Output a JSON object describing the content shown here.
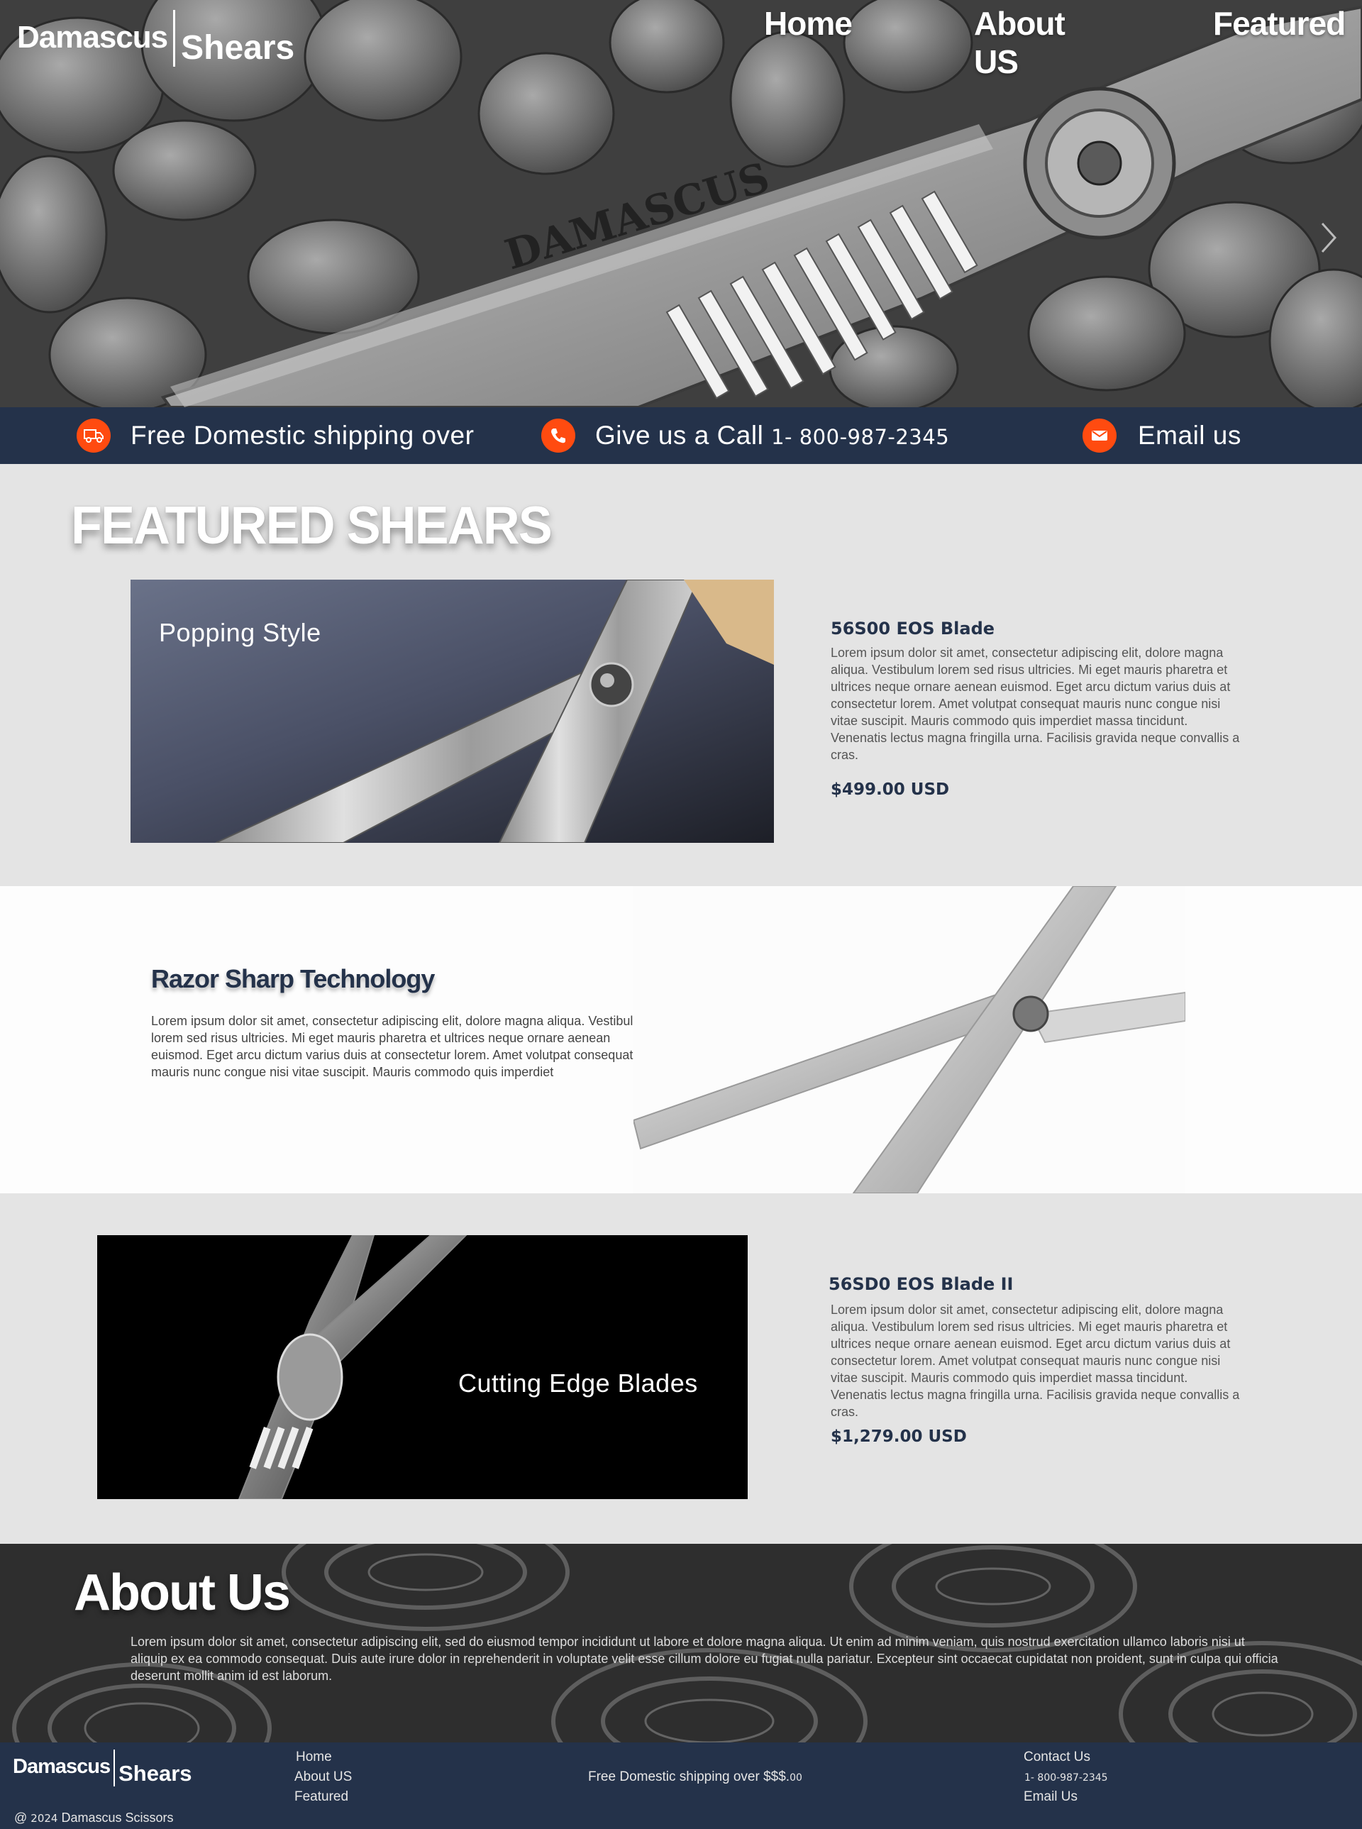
{
  "brand": {
    "word1": "Damascus",
    "word2": "Shears"
  },
  "nav": {
    "home": "Home",
    "about": "About US",
    "featured": "Featured"
  },
  "hero": {
    "blade_engraving": "DAMASCUS"
  },
  "infobar": {
    "shipping": "Free Domestic shipping over",
    "call_label": "Give us a Call",
    "call_number": "1- 800-987-2345",
    "email": "Email us"
  },
  "featured": {
    "title": "FEATURED SHEARS",
    "product1": {
      "caption": "Popping Style",
      "name": "56S00 EOS Blade",
      "description": "Lorem ipsum dolor sit amet, consectetur adipiscing elit, dolore magna aliqua. Vestibulum lorem sed risus ultricies. Mi eget mauris pharetra et ultrices neque ornare aenean euismod. Eget arcu dictum varius duis at consectetur lorem. Amet volutpat consequat mauris nunc congue nisi vitae suscipit. Mauris commodo quis imperdiet massa tincidunt. Venenatis lectus magna fringilla urna. Facilisis gravida neque convallis a cras.",
      "price": "$499.00 USD"
    }
  },
  "razor": {
    "title": "Razor Sharp Technology",
    "description": "Lorem ipsum dolor sit amet, consectetur adipiscing elit, dolore magna aliqua. Vestibulum lorem sed risus ultricies. Mi eget mauris pharetra et ultrices neque ornare aenean euismod. Eget arcu dictum varius duis at consectetur lorem. Amet volutpat consequat mauris nunc congue nisi vitae suscipit. Mauris commodo quis imperdiet"
  },
  "product2": {
    "caption": "Cutting Edge Blades",
    "name": "56SD0 EOS Blade II",
    "description": "Lorem ipsum dolor sit amet, consectetur adipiscing elit, dolore magna aliqua. Vestibulum lorem sed risus ultricies. Mi eget mauris pharetra et ultrices neque ornare aenean euismod. Eget arcu dictum varius duis at consectetur lorem. Amet volutpat consequat mauris nunc congue nisi vitae suscipit. Mauris commodo quis imperdiet massa tincidunt. Venenatis lectus magna fringilla urna. Facilisis gravida neque convallis a cras.",
    "price": "$1,279.00 USD"
  },
  "about": {
    "title": "About Us",
    "text": "Lorem ipsum dolor sit amet, consectetur adipiscing elit, sed do eiusmod tempor incididunt ut labore et dolore magna aliqua. Ut enim ad minim veniam, quis nostrud exercitation ullamco laboris nisi ut aliquip ex ea commodo consequat. Duis aute irure dolor in reprehenderit in voluptate velit esse cillum dolore eu fugiat nulla pariatur. Excepteur sint occaecat cupidatat non proident, sunt in culpa qui officia deserunt mollit anim id est laborum."
  },
  "footer": {
    "links": {
      "home": "Home",
      "about": "About US",
      "featured": "Featured"
    },
    "shipping_prefix": "Free Domestic shipping over $$$.",
    "shipping_cents": "00",
    "contact": "Contact Us",
    "phone": "1- 800-987-2345",
    "email": "Email Us",
    "copyright_prefix": "@",
    "copyright_year": "2024",
    "copyright_name": "Damascus Scissors"
  },
  "colors": {
    "navy": "#24324a",
    "accent_orange": "#ff4b10",
    "section_gray": "#e4e4e4"
  },
  "icons": [
    "truck-icon",
    "phone-icon",
    "envelope-icon",
    "chevron-right-icon"
  ]
}
